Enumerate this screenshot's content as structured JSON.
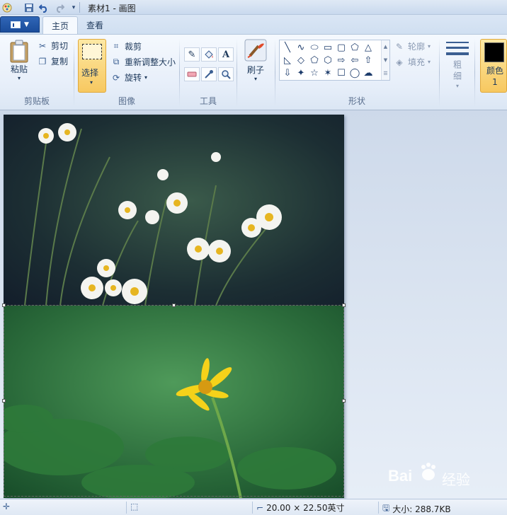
{
  "titlebar": {
    "title": "素材1 - 画图",
    "icons": [
      "paint-app-icon",
      "save-icon",
      "undo-icon",
      "redo-icon",
      "customize-dropdown-icon"
    ]
  },
  "tabs": [
    {
      "label": "主页",
      "active": true
    },
    {
      "label": "查看",
      "active": false
    }
  ],
  "clipboard": {
    "paste_label": "粘贴",
    "cut_label": "剪切",
    "copy_label": "复制",
    "group_label": "剪贴板"
  },
  "image": {
    "select_label": "选择",
    "crop_label": "裁剪",
    "resize_label": "重新调整大小",
    "rotate_label": "旋转",
    "group_label": "图像"
  },
  "tools": {
    "group_label": "工具",
    "items": [
      "pencil-icon",
      "fill-icon",
      "text-icon",
      "eraser-icon",
      "color-picker-icon",
      "magnifier-icon"
    ]
  },
  "brushes": {
    "label": "刷子"
  },
  "shapes": {
    "group_label": "形状",
    "outline_label": "轮廓",
    "fill_label": "填充",
    "glyphs": [
      "╲",
      "∿",
      "⬭",
      "▭",
      "▢",
      "⬠",
      "△",
      "◺",
      "◇",
      "⬠",
      "⬡",
      "⇨",
      "⇦",
      "⇧",
      "⇩",
      "✦",
      "☆",
      "✶",
      "☐",
      "◯",
      "☁"
    ]
  },
  "size": {
    "label": "粗细"
  },
  "color1": {
    "label": "颜色 1",
    "value": "#000000"
  },
  "statusbar": {
    "dimensions": "20.00 × 22.50英寸",
    "file_size": "大小: 288.7KB"
  },
  "watermark": {
    "text_a": "Bai",
    "text_b": "经验"
  },
  "colors": {
    "accent": "#1b4c9b",
    "selected_button": "#f7c860",
    "workspace": "#d6e1ef"
  }
}
